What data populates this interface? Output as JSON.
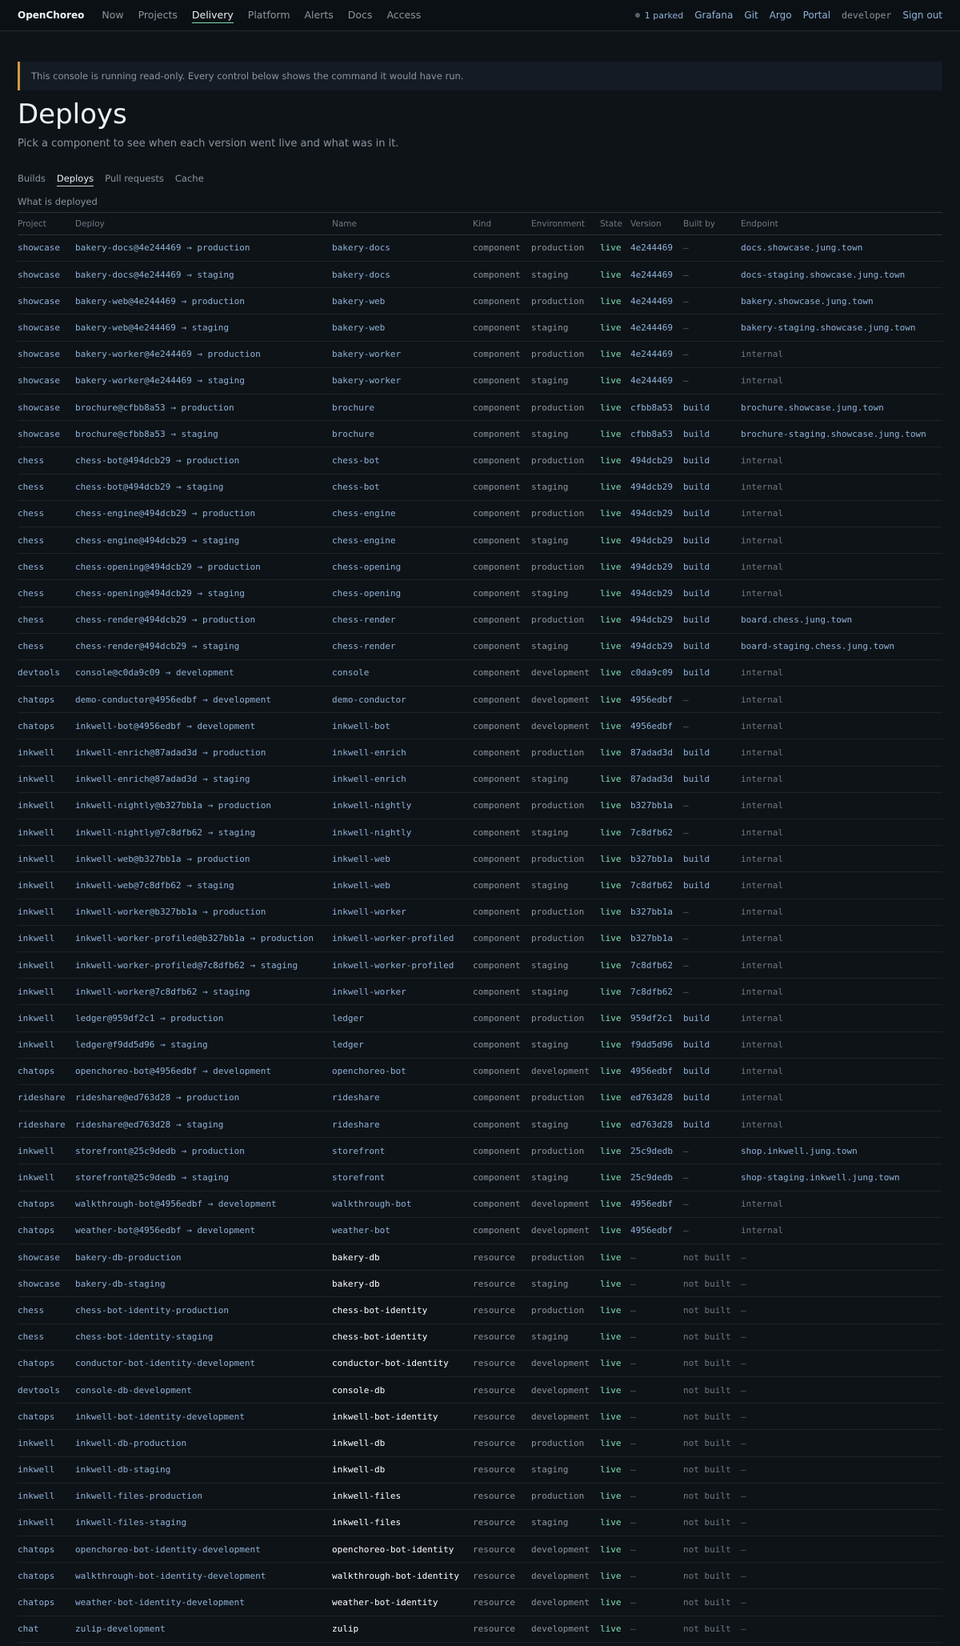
{
  "nav": {
    "brand": "OpenChoreo",
    "items": [
      "Now",
      "Projects",
      "Delivery",
      "Platform",
      "Alerts",
      "Docs",
      "Access"
    ],
    "active": "Delivery",
    "parked": "1 parked",
    "links": [
      "Grafana",
      "Git",
      "Argo",
      "Portal"
    ],
    "user": "developer",
    "signout": "Sign out"
  },
  "notice": "This console is running read-only. Every control below shows the command it would have run.",
  "page": {
    "title": "Deploys",
    "subtitle": "Pick a component to see when each version went live and what was in it."
  },
  "subtabs": [
    "Builds",
    "Deploys",
    "Pull requests",
    "Cache"
  ],
  "active_subtab": "Deploys",
  "table_caption": "What is deployed",
  "columns": [
    "Project",
    "Deploy",
    "Name",
    "Kind",
    "Environment",
    "State",
    "Version",
    "Built by",
    "Endpoint"
  ],
  "rows": [
    [
      "showcase",
      "bakery-docs@4e244469 → production",
      "bakery-docs",
      "component",
      "production",
      "live",
      "4e244469",
      "—",
      "docs.showcase.jung.town"
    ],
    [
      "showcase",
      "bakery-docs@4e244469 → staging",
      "bakery-docs",
      "component",
      "staging",
      "live",
      "4e244469",
      "—",
      "docs-staging.showcase.jung.town"
    ],
    [
      "showcase",
      "bakery-web@4e244469 → production",
      "bakery-web",
      "component",
      "production",
      "live",
      "4e244469",
      "—",
      "bakery.showcase.jung.town"
    ],
    [
      "showcase",
      "bakery-web@4e244469 → staging",
      "bakery-web",
      "component",
      "staging",
      "live",
      "4e244469",
      "—",
      "bakery-staging.showcase.jung.town"
    ],
    [
      "showcase",
      "bakery-worker@4e244469 → production",
      "bakery-worker",
      "component",
      "production",
      "live",
      "4e244469",
      "—",
      "internal"
    ],
    [
      "showcase",
      "bakery-worker@4e244469 → staging",
      "bakery-worker",
      "component",
      "staging",
      "live",
      "4e244469",
      "—",
      "internal"
    ],
    [
      "showcase",
      "brochure@cfbb8a53 → production",
      "brochure",
      "component",
      "production",
      "live",
      "cfbb8a53",
      "build",
      "brochure.showcase.jung.town"
    ],
    [
      "showcase",
      "brochure@cfbb8a53 → staging",
      "brochure",
      "component",
      "staging",
      "live",
      "cfbb8a53",
      "build",
      "brochure-staging.showcase.jung.town"
    ],
    [
      "chess",
      "chess-bot@494dcb29 → production",
      "chess-bot",
      "component",
      "production",
      "live",
      "494dcb29",
      "build",
      "internal"
    ],
    [
      "chess",
      "chess-bot@494dcb29 → staging",
      "chess-bot",
      "component",
      "staging",
      "live",
      "494dcb29",
      "build",
      "internal"
    ],
    [
      "chess",
      "chess-engine@494dcb29 → production",
      "chess-engine",
      "component",
      "production",
      "live",
      "494dcb29",
      "build",
      "internal"
    ],
    [
      "chess",
      "chess-engine@494dcb29 → staging",
      "chess-engine",
      "component",
      "staging",
      "live",
      "494dcb29",
      "build",
      "internal"
    ],
    [
      "chess",
      "chess-opening@494dcb29 → production",
      "chess-opening",
      "component",
      "production",
      "live",
      "494dcb29",
      "build",
      "internal"
    ],
    [
      "chess",
      "chess-opening@494dcb29 → staging",
      "chess-opening",
      "component",
      "staging",
      "live",
      "494dcb29",
      "build",
      "internal"
    ],
    [
      "chess",
      "chess-render@494dcb29 → production",
      "chess-render",
      "component",
      "production",
      "live",
      "494dcb29",
      "build",
      "board.chess.jung.town"
    ],
    [
      "chess",
      "chess-render@494dcb29 → staging",
      "chess-render",
      "component",
      "staging",
      "live",
      "494dcb29",
      "build",
      "board-staging.chess.jung.town"
    ],
    [
      "devtools",
      "console@c0da9c09 → development",
      "console",
      "component",
      "development",
      "live",
      "c0da9c09",
      "build",
      "internal"
    ],
    [
      "chatops",
      "demo-conductor@4956edbf → development",
      "demo-conductor",
      "component",
      "development",
      "live",
      "4956edbf",
      "—",
      "internal"
    ],
    [
      "chatops",
      "inkwell-bot@4956edbf → development",
      "inkwell-bot",
      "component",
      "development",
      "live",
      "4956edbf",
      "—",
      "internal"
    ],
    [
      "inkwell",
      "inkwell-enrich@87adad3d → production",
      "inkwell-enrich",
      "component",
      "production",
      "live",
      "87adad3d",
      "build",
      "internal"
    ],
    [
      "inkwell",
      "inkwell-enrich@87adad3d → staging",
      "inkwell-enrich",
      "component",
      "staging",
      "live",
      "87adad3d",
      "build",
      "internal"
    ],
    [
      "inkwell",
      "inkwell-nightly@b327bb1a → production",
      "inkwell-nightly",
      "component",
      "production",
      "live",
      "b327bb1a",
      "—",
      "internal"
    ],
    [
      "inkwell",
      "inkwell-nightly@7c8dfb62 → staging",
      "inkwell-nightly",
      "component",
      "staging",
      "live",
      "7c8dfb62",
      "—",
      "internal"
    ],
    [
      "inkwell",
      "inkwell-web@b327bb1a → production",
      "inkwell-web",
      "component",
      "production",
      "live",
      "b327bb1a",
      "build",
      "internal"
    ],
    [
      "inkwell",
      "inkwell-web@7c8dfb62 → staging",
      "inkwell-web",
      "component",
      "staging",
      "live",
      "7c8dfb62",
      "build",
      "internal"
    ],
    [
      "inkwell",
      "inkwell-worker@b327bb1a → production",
      "inkwell-worker",
      "component",
      "production",
      "live",
      "b327bb1a",
      "—",
      "internal"
    ],
    [
      "inkwell",
      "inkwell-worker-profiled@b327bb1a → production",
      "inkwell-worker-profiled",
      "component",
      "production",
      "live",
      "b327bb1a",
      "—",
      "internal"
    ],
    [
      "inkwell",
      "inkwell-worker-profiled@7c8dfb62 → staging",
      "inkwell-worker-profiled",
      "component",
      "staging",
      "live",
      "7c8dfb62",
      "—",
      "internal"
    ],
    [
      "inkwell",
      "inkwell-worker@7c8dfb62 → staging",
      "inkwell-worker",
      "component",
      "staging",
      "live",
      "7c8dfb62",
      "—",
      "internal"
    ],
    [
      "inkwell",
      "ledger@959df2c1 → production",
      "ledger",
      "component",
      "production",
      "live",
      "959df2c1",
      "build",
      "internal"
    ],
    [
      "inkwell",
      "ledger@f9dd5d96 → staging",
      "ledger",
      "component",
      "staging",
      "live",
      "f9dd5d96",
      "build",
      "internal"
    ],
    [
      "chatops",
      "openchoreo-bot@4956edbf → development",
      "openchoreo-bot",
      "component",
      "development",
      "live",
      "4956edbf",
      "build",
      "internal"
    ],
    [
      "rideshare",
      "rideshare@ed763d28 → production",
      "rideshare",
      "component",
      "production",
      "live",
      "ed763d28",
      "build",
      "internal"
    ],
    [
      "rideshare",
      "rideshare@ed763d28 → staging",
      "rideshare",
      "component",
      "staging",
      "live",
      "ed763d28",
      "build",
      "internal"
    ],
    [
      "inkwell",
      "storefront@25c9dedb → production",
      "storefront",
      "component",
      "production",
      "live",
      "25c9dedb",
      "—",
      "shop.inkwell.jung.town"
    ],
    [
      "inkwell",
      "storefront@25c9dedb → staging",
      "storefront",
      "component",
      "staging",
      "live",
      "25c9dedb",
      "—",
      "shop-staging.inkwell.jung.town"
    ],
    [
      "chatops",
      "walkthrough-bot@4956edbf → development",
      "walkthrough-bot",
      "component",
      "development",
      "live",
      "4956edbf",
      "—",
      "internal"
    ],
    [
      "chatops",
      "weather-bot@4956edbf → development",
      "weather-bot",
      "component",
      "development",
      "live",
      "4956edbf",
      "—",
      "internal"
    ],
    [
      "showcase",
      "bakery-db-production",
      "bakery-db",
      "resource",
      "production",
      "live",
      "—",
      "not built",
      "—"
    ],
    [
      "showcase",
      "bakery-db-staging",
      "bakery-db",
      "resource",
      "staging",
      "live",
      "—",
      "not built",
      "—"
    ],
    [
      "chess",
      "chess-bot-identity-production",
      "chess-bot-identity",
      "resource",
      "production",
      "live",
      "—",
      "not built",
      "—"
    ],
    [
      "chess",
      "chess-bot-identity-staging",
      "chess-bot-identity",
      "resource",
      "staging",
      "live",
      "—",
      "not built",
      "—"
    ],
    [
      "chatops",
      "conductor-bot-identity-development",
      "conductor-bot-identity",
      "resource",
      "development",
      "live",
      "—",
      "not built",
      "—"
    ],
    [
      "devtools",
      "console-db-development",
      "console-db",
      "resource",
      "development",
      "live",
      "—",
      "not built",
      "—"
    ],
    [
      "chatops",
      "inkwell-bot-identity-development",
      "inkwell-bot-identity",
      "resource",
      "development",
      "live",
      "—",
      "not built",
      "—"
    ],
    [
      "inkwell",
      "inkwell-db-production",
      "inkwell-db",
      "resource",
      "production",
      "live",
      "—",
      "not built",
      "—"
    ],
    [
      "inkwell",
      "inkwell-db-staging",
      "inkwell-db",
      "resource",
      "staging",
      "live",
      "—",
      "not built",
      "—"
    ],
    [
      "inkwell",
      "inkwell-files-production",
      "inkwell-files",
      "resource",
      "production",
      "live",
      "—",
      "not built",
      "—"
    ],
    [
      "inkwell",
      "inkwell-files-staging",
      "inkwell-files",
      "resource",
      "staging",
      "live",
      "—",
      "not built",
      "—"
    ],
    [
      "chatops",
      "openchoreo-bot-identity-development",
      "openchoreo-bot-identity",
      "resource",
      "development",
      "live",
      "—",
      "not built",
      "—"
    ],
    [
      "chatops",
      "walkthrough-bot-identity-development",
      "walkthrough-bot-identity",
      "resource",
      "development",
      "live",
      "—",
      "not built",
      "—"
    ],
    [
      "chatops",
      "weather-bot-identity-development",
      "weather-bot-identity",
      "resource",
      "development",
      "live",
      "—",
      "not built",
      "—"
    ],
    [
      "chat",
      "zulip-development",
      "zulip",
      "resource",
      "development",
      "live",
      "—",
      "not built",
      "—"
    ]
  ]
}
